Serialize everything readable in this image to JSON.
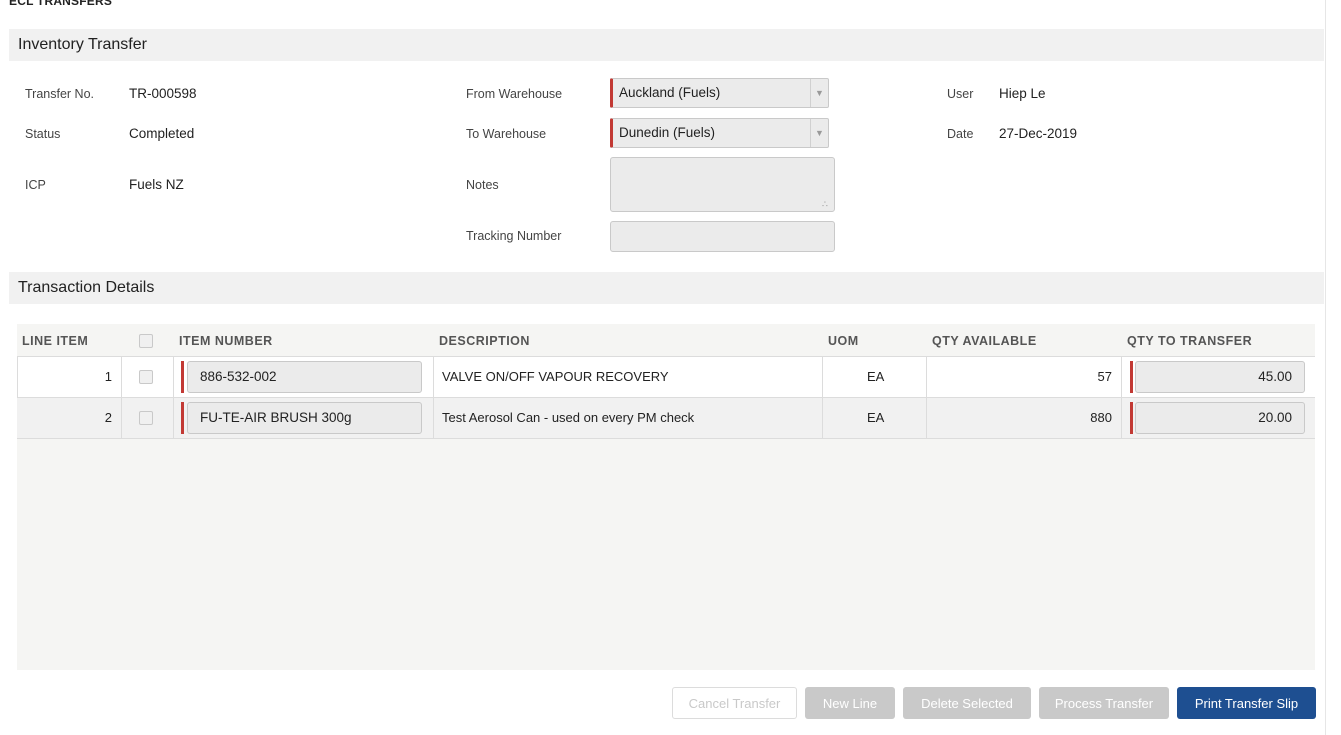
{
  "page": {
    "heading": "ECL TRANSFERS"
  },
  "inventory_transfer": {
    "title": "Inventory Transfer",
    "transfer_no_label": "Transfer No.",
    "transfer_no": "TR-000598",
    "status_label": "Status",
    "status": "Completed",
    "icp_label": "ICP",
    "icp": "Fuels NZ",
    "from_warehouse_label": "From Warehouse",
    "from_warehouse": "Auckland (Fuels)",
    "to_warehouse_label": "To Warehouse",
    "to_warehouse": "Dunedin (Fuels)",
    "notes_label": "Notes",
    "notes": "",
    "tracking_number_label": "Tracking Number",
    "tracking_number": "",
    "user_label": "User",
    "user": "Hiep Le",
    "date_label": "Date",
    "date": "27-Dec-2019"
  },
  "transaction_details": {
    "title": "Transaction Details",
    "columns": {
      "line_item": "LINE ITEM",
      "item_number": "ITEM NUMBER",
      "description": "DESCRIPTION",
      "uom": "UOM",
      "qty_available": "QTY AVAILABLE",
      "qty_to_transfer": "QTY TO TRANSFER"
    },
    "rows": [
      {
        "line": "1",
        "item_number": "886-532-002",
        "description": "VALVE ON/OFF VAPOUR RECOVERY",
        "uom": "EA",
        "qty_available": "57",
        "qty_to_transfer": "45.00"
      },
      {
        "line": "2",
        "item_number": "FU-TE-AIR BRUSH 300g",
        "description": "Test Aerosol Can - used on every PM check",
        "uom": "EA",
        "qty_available": "880",
        "qty_to_transfer": "20.00"
      }
    ]
  },
  "actions": {
    "cancel_transfer": "Cancel Transfer",
    "new_line": "New Line",
    "delete_selected": "Delete Selected",
    "process_transfer": "Process Transfer",
    "print_transfer_slip": "Print Transfer Slip"
  },
  "colors": {
    "required_marker": "#c23934",
    "primary_button": "#1e4f91",
    "disabled_button": "#c9c9c9",
    "section_bar": "#f1f1f1"
  },
  "icons": {
    "select_arrow": "chevron-down-icon",
    "textarea_resize": "resize-grip-icon"
  }
}
